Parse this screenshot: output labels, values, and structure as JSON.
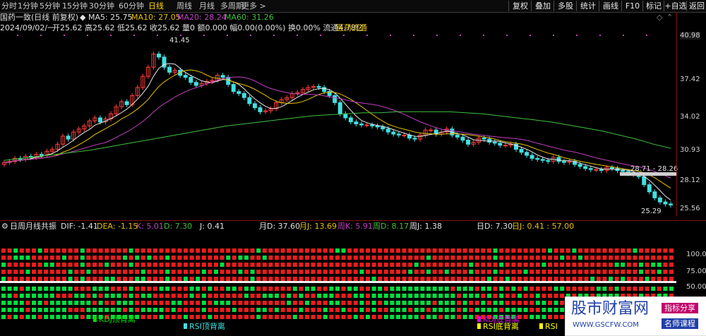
{
  "toolbar": {
    "left_items": [
      "分时",
      "1分钟",
      "5分钟",
      "15分钟",
      "30分钟",
      "60分钟",
      "日线",
      "周线",
      "月线",
      "多周期",
      "更多 >"
    ],
    "active": "日线",
    "right_items": [
      "复权",
      "叠加",
      "多股",
      "统计",
      "画线",
      "F10",
      "标记",
      "+自选",
      "返回"
    ]
  },
  "info": {
    "stock_title": "国药一致(日线 前复权)",
    "ma_label": "◆ MA5: 25.75",
    "ma10": "MA10: 27.05",
    "ma20": "MA20: 28.24",
    "ma60": "MA60: 31.26",
    "date": "2024/09/02/一",
    "ohlc": "开25.62 高25.62 低25.62 收25.62 量0 额0.000 幅0.00(0.00%) 换0.00% 流通4.78亿",
    "sector": "医药流通",
    "colors": {
      "ma5": "#e8e8e8",
      "ma10": "#e8c000",
      "ma20": "#c040c0",
      "ma60": "#40c040"
    }
  },
  "axis": {
    "price_labels": [
      "40.98",
      "37.42",
      "34.02",
      "30.93",
      "28.12",
      "25.56"
    ],
    "ind_labels": [
      "100.0",
      "75.00",
      "50.00",
      "25.00"
    ],
    "ind_label_100": "100.0"
  },
  "annotations": {
    "high": "41.45",
    "low": "25.29",
    "range": "28.71 - 28.26"
  },
  "indicator": {
    "name": "日周月线共振",
    "values": [
      {
        "text": "DIF: -1.41",
        "color": "#e0e0e0"
      },
      {
        "text": "DEA: -1.15",
        "color": "#e8c000"
      },
      {
        "text": "K: 5.01",
        "color": "#c040c0"
      },
      {
        "text": "D: 7.30",
        "color": "#40c040"
      },
      {
        "text": "J: 0.41",
        "color": "#e0e0e0"
      },
      {
        "text": "月D: 37.60",
        "color": "#e0e0e0"
      },
      {
        "text": "月J: 13.69",
        "color": "#e8c000"
      },
      {
        "text": "周K: 5.91",
        "color": "#c040c0"
      },
      {
        "text": "周D: 8.17",
        "color": "#40c040"
      },
      {
        "text": "周J: 1.38",
        "color": "#e0e0e0"
      },
      {
        "text": "日D: 7.30",
        "color": "#e0e0e0"
      },
      {
        "text": "日J: 0.41 : 57.00",
        "color": "#e8c000"
      }
    ]
  },
  "legend": [
    {
      "text": "KDJ顶背离",
      "color": "#00e000"
    },
    {
      "text": "RSI顶背离",
      "color": "#40e0e0"
    },
    {
      "text": "KDJ底背离",
      "color": "#e000e0"
    },
    {
      "text": "RSI底背离",
      "color": "#ffff00"
    },
    {
      "text": "RSI",
      "color": "#ffff00"
    }
  ],
  "watermark": {
    "site": "股市财富网",
    "url": "WWW.GSCFW.COM",
    "badge1": "指标分享",
    "badge2": "名师课程"
  },
  "chart_data": {
    "type": "candlestick",
    "ylim": [
      25.0,
      42.0
    ],
    "close": [
      29.8,
      29.9,
      30.2,
      30.1,
      30.4,
      30.3,
      30.6,
      30.5,
      30.9,
      31.1,
      31.6,
      32.4,
      32.1,
      32.8,
      33.1,
      33.4,
      33.9,
      34.2,
      33.8,
      34.1,
      34.6,
      35.3,
      35.8,
      35.5,
      36.4,
      37.2,
      38.3,
      39.2,
      40.5,
      40.2,
      39.2,
      38.7,
      38.9,
      38.4,
      38.2,
      37.7,
      37.4,
      37.6,
      37.8,
      37.9,
      38.4,
      38.2,
      37.5,
      36.8,
      36.6,
      36.2,
      35.6,
      35.2,
      34.8,
      34.9,
      35.1,
      35.7,
      36.0,
      36.2,
      36.6,
      36.7,
      37.0,
      37.2,
      37.3,
      37.2,
      36.8,
      36.4,
      35.7,
      34.6,
      34.2,
      33.8,
      33.6,
      33.5,
      33.5,
      33.4,
      33.3,
      33.1,
      32.8,
      32.6,
      32.5,
      32.5,
      32.2,
      32.1,
      32.5,
      33.0,
      33.0,
      32.6,
      32.8,
      33.1,
      32.5,
      32.3,
      32.0,
      31.6,
      31.8,
      32.2,
      32.1,
      31.8,
      31.7,
      31.5,
      31.5,
      31.6,
      31.1,
      30.8,
      30.5,
      30.2,
      30.1,
      30.0,
      29.9,
      30.3,
      29.9,
      29.8,
      29.9,
      29.6,
      29.4,
      29.2,
      29.1,
      29.1,
      29.0,
      29.3,
      29.2,
      29.0,
      28.9,
      28.7,
      28.6,
      28.4,
      27.6,
      26.9,
      26.3,
      25.9,
      25.7,
      25.6
    ],
    "ma60": [
      30.0,
      30.2,
      30.4,
      30.6,
      30.8,
      31.0,
      31.3,
      31.6,
      31.9,
      32.2,
      32.5,
      32.8,
      33.1,
      33.4,
      33.6,
      33.8,
      34.0,
      34.2,
      34.4,
      34.5,
      34.6,
      34.7,
      34.7,
      34.8,
      34.8,
      34.8,
      34.8,
      34.7,
      34.6,
      34.4,
      34.2,
      34.0,
      33.8,
      33.5,
      33.2,
      32.9,
      32.5,
      32.1,
      31.6,
      31.2
    ]
  }
}
